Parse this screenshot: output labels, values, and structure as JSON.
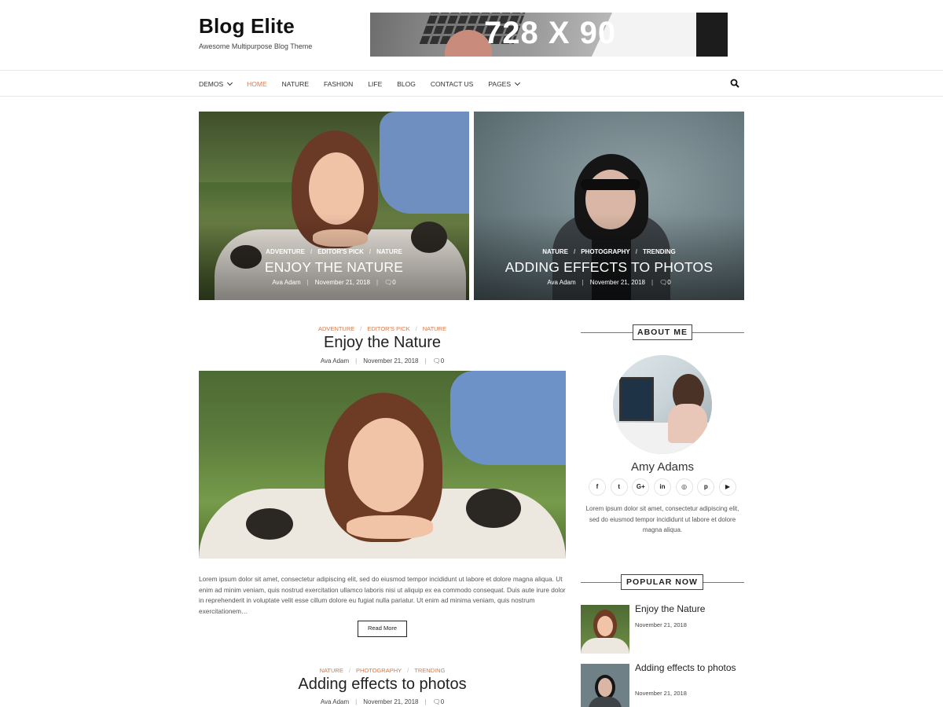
{
  "site": {
    "title": "Blog Elite",
    "tagline": "Awesome Multipurpose Blog Theme"
  },
  "ad": {
    "text": "728 X 90"
  },
  "nav": {
    "items": [
      {
        "label": "DEMOS",
        "has_dropdown": true,
        "active": false
      },
      {
        "label": "HOME",
        "has_dropdown": false,
        "active": true
      },
      {
        "label": "NATURE",
        "has_dropdown": false,
        "active": false
      },
      {
        "label": "FASHION",
        "has_dropdown": false,
        "active": false
      },
      {
        "label": "LIFE",
        "has_dropdown": false,
        "active": false
      },
      {
        "label": "BLOG",
        "has_dropdown": false,
        "active": false
      },
      {
        "label": "CONTACT US",
        "has_dropdown": false,
        "active": false
      },
      {
        "label": "PAGES",
        "has_dropdown": true,
        "active": false
      }
    ],
    "search_icon": "search-icon"
  },
  "featured": [
    {
      "categories": [
        "ADVENTURE",
        "EDITOR'S PICK",
        "NATURE"
      ],
      "title": "ENJOY THE NATURE",
      "author": "Ava Adam",
      "date": "November 21, 2018",
      "comments": "0"
    },
    {
      "categories": [
        "NATURE",
        "PHOTOGRAPHY",
        "TRENDING"
      ],
      "title": "ADDING EFFECTS TO PHOTOS",
      "author": "Ava Adam",
      "date": "November 21, 2018",
      "comments": "0"
    }
  ],
  "posts": [
    {
      "categories": [
        "ADVENTURE",
        "EDITOR'S PICK",
        "NATURE"
      ],
      "title": "Enjoy the Nature",
      "author": "Ava Adam",
      "date": "November 21, 2018",
      "comments": "0",
      "excerpt": "Lorem ipsum dolor sit amet, consectetur adipiscing elit, sed do eiusmod tempor incididunt ut labore et dolore magna aliqua. Ut enim ad minim veniam, quis nostrud exercitation ullamco laboris nisi ut aliquip ex ea commodo consequat. Duis aute irure dolor in reprehenderit in voluptate velit esse cillum dolore eu fugiat nulla pariatur. Ut enim ad minima veniam, quis nostrum exercitationem…",
      "read_more": "Read More"
    },
    {
      "categories": [
        "NATURE",
        "PHOTOGRAPHY",
        "TRENDING"
      ],
      "title": "Adding effects to photos",
      "author": "Ava Adam",
      "date": "November 21, 2018",
      "comments": "0"
    }
  ],
  "sidebar": {
    "about": {
      "heading": "ABOUT ME",
      "name": "Amy Adams",
      "text": "Lorem ipsum dolor sit amet, consectetur adipiscing elit, sed do eiusmod tempor incididunt ut labore et dolore magna aliqua.",
      "socials": [
        {
          "icon": "facebook-icon",
          "glyph": "f"
        },
        {
          "icon": "twitter-icon",
          "glyph": "t"
        },
        {
          "icon": "google-plus-icon",
          "glyph": "G+"
        },
        {
          "icon": "linkedin-icon",
          "glyph": "in"
        },
        {
          "icon": "instagram-icon",
          "glyph": "◎"
        },
        {
          "icon": "pinterest-icon",
          "glyph": "p"
        },
        {
          "icon": "youtube-icon",
          "glyph": "▶"
        }
      ]
    },
    "popular": {
      "heading": "POPULAR NOW",
      "items": [
        {
          "title": "Enjoy the Nature",
          "date": "November 21, 2018"
        },
        {
          "title": "Adding effects to photos",
          "date": "November 21, 2018"
        }
      ]
    }
  },
  "colors": {
    "accent": "#d9794a",
    "text": "#222222",
    "border": "#e6e6e6"
  }
}
